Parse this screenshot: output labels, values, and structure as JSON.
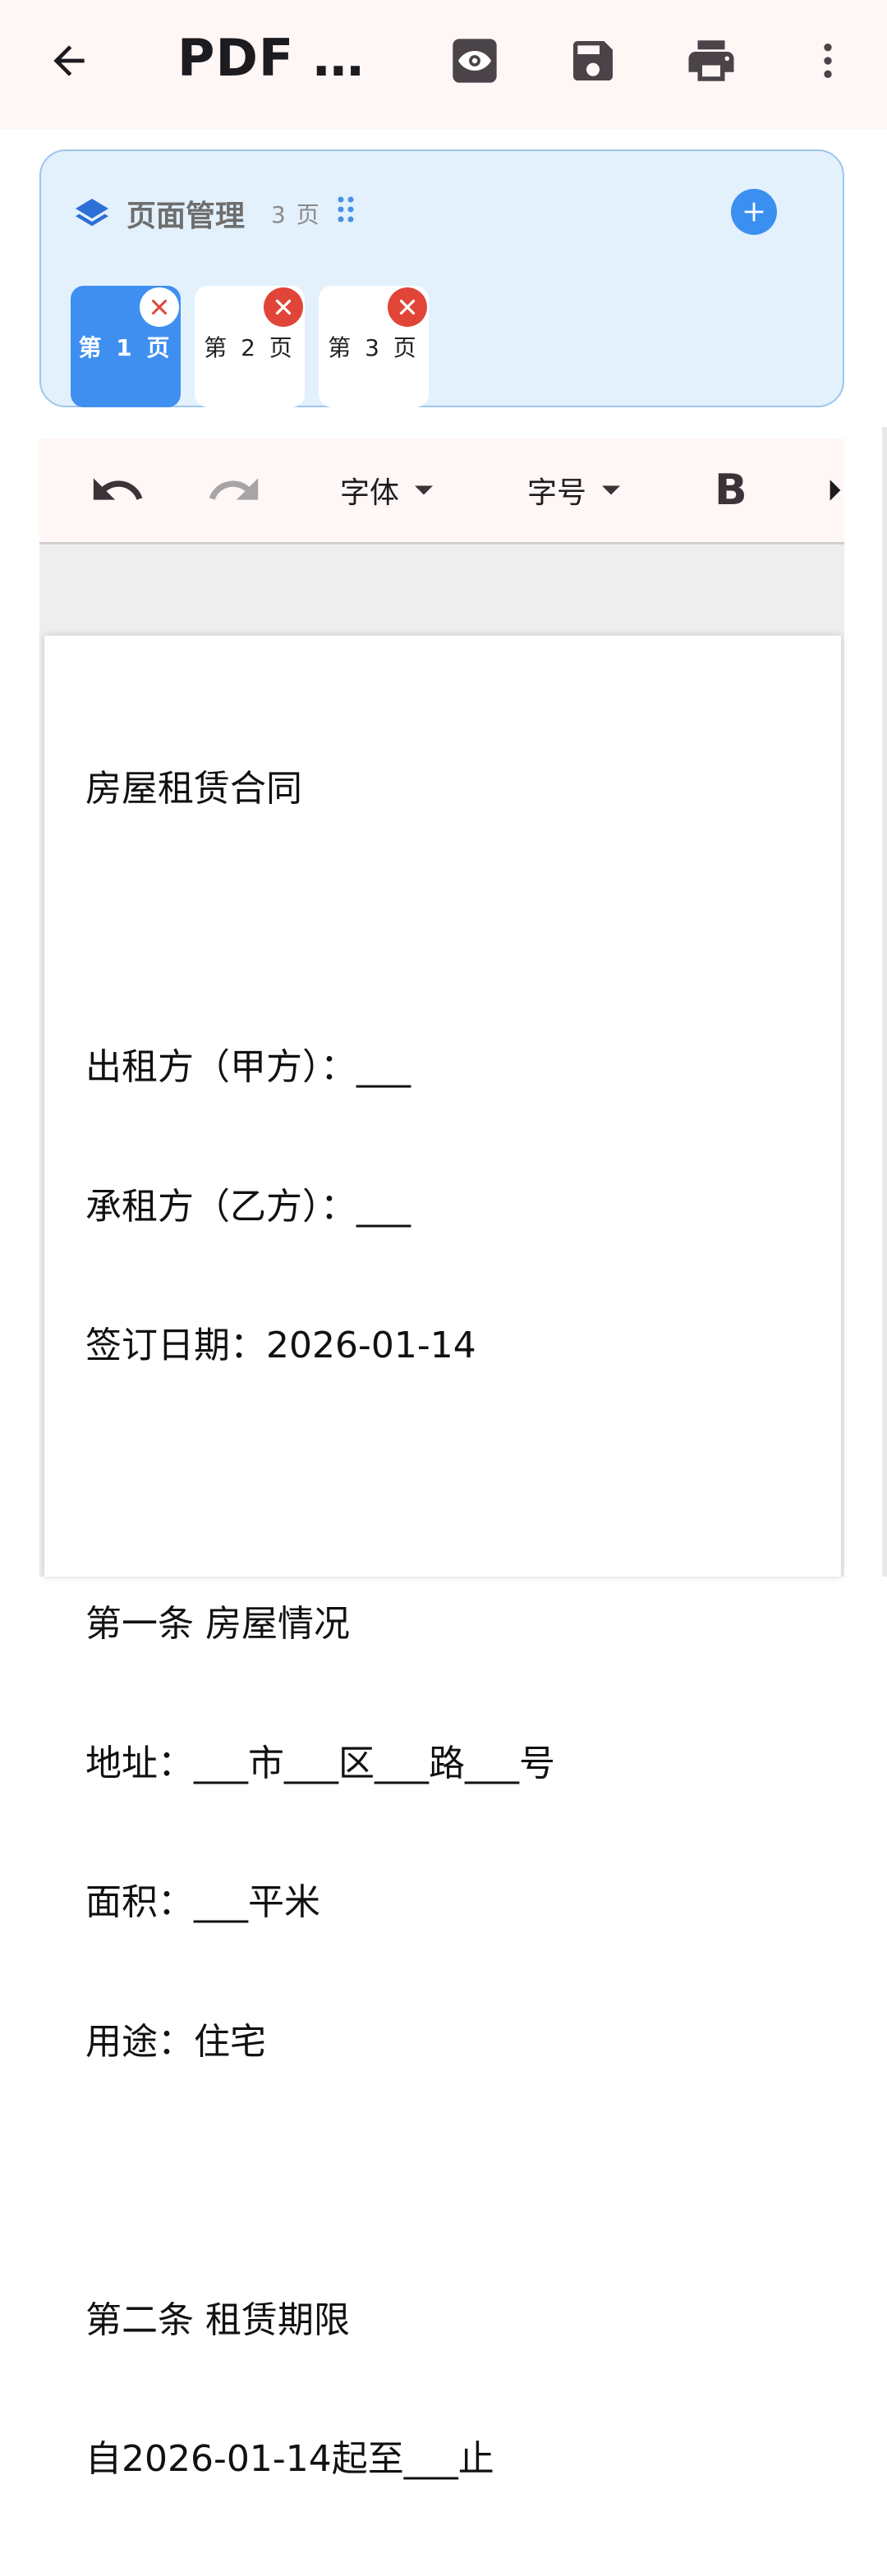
{
  "appbar": {
    "title": "PDF …",
    "icons": [
      "back-arrow-icon",
      "eye-preview-icon",
      "save-floppy-icon",
      "print-icon",
      "more-vert-icon"
    ]
  },
  "page_manager": {
    "title": "页面管理",
    "count": "3 页",
    "icons": [
      "layers-icon",
      "drag-handle-icon",
      "add-circle-icon"
    ],
    "pages": [
      {
        "label": "第 1 页",
        "active": true
      },
      {
        "label": "第 2 页",
        "active": false
      },
      {
        "label": "第 3 页",
        "active": false
      }
    ]
  },
  "toolbar": {
    "font_label": "字体",
    "size_label": "字号",
    "bold_label": "B",
    "icons": [
      "undo-icon",
      "redo-icon",
      "dropdown-arrow-icon",
      "bold-icon",
      "scroll-right-icon"
    ]
  },
  "document": {
    "lines": [
      "房屋租赁合同",
      "",
      "出租方（甲方）：___",
      "承租方（乙方）：___",
      "签订日期：2026-01-14",
      "",
      "第一条 房屋情况",
      "地址：___市___区___路___号",
      "面积：___平米",
      "用途：住宅",
      "",
      "第二条 租赁期限",
      "自2026-01-14起至___止"
    ]
  },
  "colors": {
    "appbar_bg": "#fff6f6",
    "card_bg": "#e3f1fd",
    "accent": "#3f8ff0",
    "delete_red": "#e04538"
  }
}
